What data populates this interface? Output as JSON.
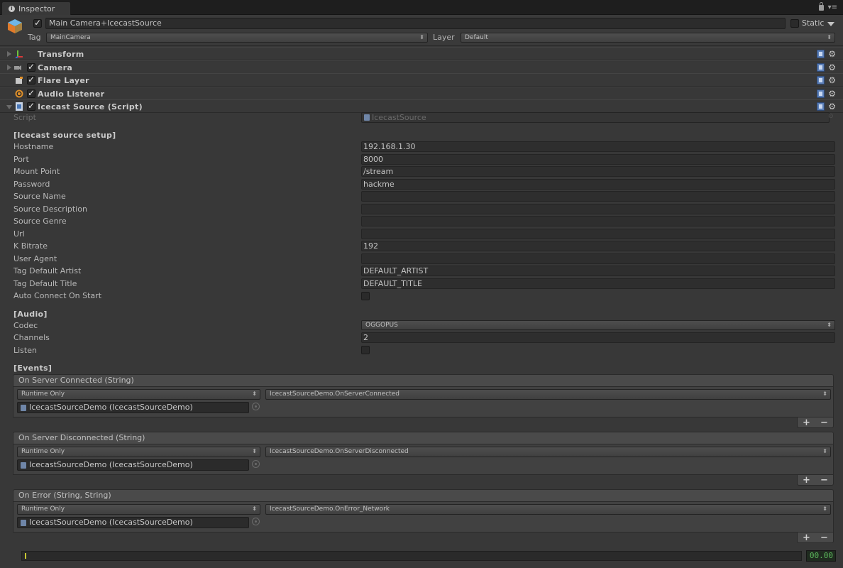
{
  "tab": {
    "label": "Inspector"
  },
  "header": {
    "object_name": "Main Camera+IcecastSource",
    "static_label": "Static",
    "tag_label": "Tag",
    "tag_value": "MainCamera",
    "layer_label": "Layer",
    "layer_value": "Default"
  },
  "components": [
    {
      "title": "Transform"
    },
    {
      "title": "Camera"
    },
    {
      "title": "Flare Layer"
    },
    {
      "title": "Audio Listener"
    },
    {
      "title": "Icecast Source (Script)"
    }
  ],
  "script_row": {
    "label": "Script",
    "value": "IcecastSource"
  },
  "setup": {
    "header": "[Icecast source setup]",
    "rows": [
      {
        "label": "Hostname",
        "value": "192.168.1.30"
      },
      {
        "label": "Port",
        "value": "8000"
      },
      {
        "label": "Mount Point",
        "value": "/stream"
      },
      {
        "label": "Password",
        "value": "hackme"
      },
      {
        "label": "Source Name",
        "value": ""
      },
      {
        "label": "Source Description",
        "value": ""
      },
      {
        "label": "Source Genre",
        "value": ""
      },
      {
        "label": "Url",
        "value": ""
      },
      {
        "label": "K Bitrate",
        "value": "192"
      },
      {
        "label": "User Agent",
        "value": ""
      },
      {
        "label": "Tag Default Artist",
        "value": "DEFAULT_ARTIST"
      },
      {
        "label": "Tag Default Title",
        "value": "DEFAULT_TITLE"
      }
    ],
    "auto_connect_label": "Auto Connect On Start"
  },
  "audio": {
    "header": "[Audio]",
    "codec_label": "Codec",
    "codec_value": "OGGOPUS",
    "channels_label": "Channels",
    "channels_value": "2",
    "listen_label": "Listen"
  },
  "events": {
    "header": "[Events]",
    "items": [
      {
        "title": "On Server Connected (String)",
        "runtime": "Runtime Only",
        "method": "IcecastSourceDemo.OnServerConnected",
        "object": "IcecastSourceDemo (IcecastSourceDemo)"
      },
      {
        "title": "On Server Disconnected (String)",
        "runtime": "Runtime Only",
        "method": "IcecastSourceDemo.OnServerDisconnected",
        "object": "IcecastSourceDemo (IcecastSourceDemo)"
      },
      {
        "title": "On Error (String, String)",
        "runtime": "Runtime Only",
        "method": "IcecastSourceDemo.OnError_Network",
        "object": "IcecastSourceDemo (IcecastSourceDemo)"
      }
    ]
  },
  "timeline": {
    "time": "00.00"
  }
}
